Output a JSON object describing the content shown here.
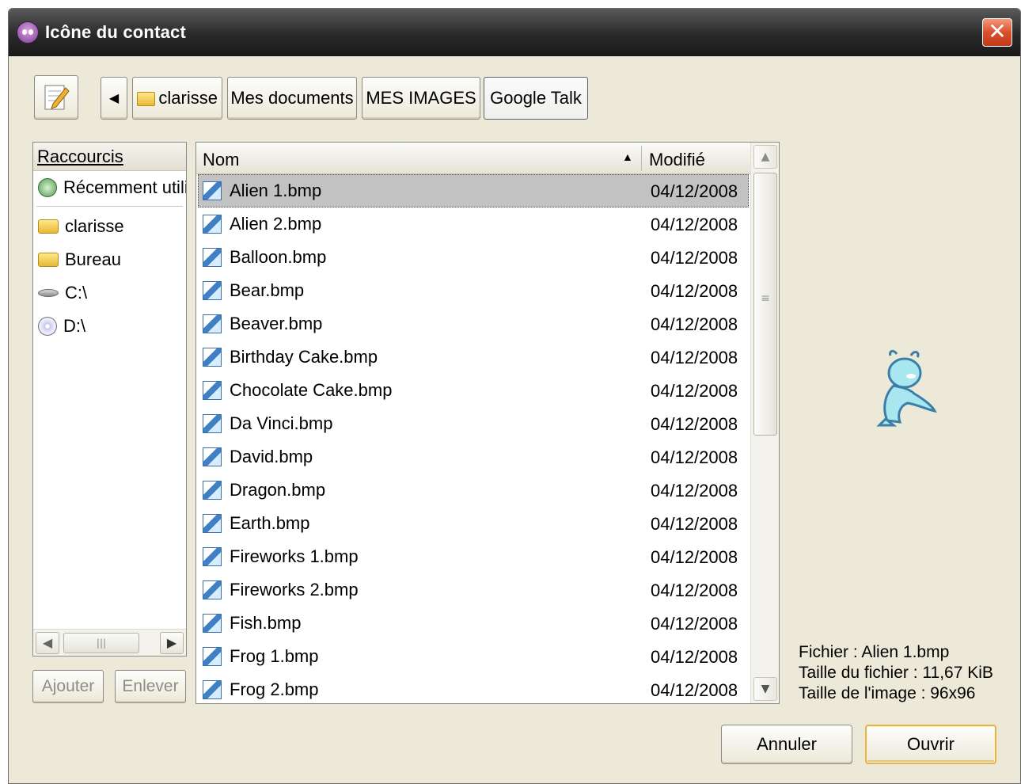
{
  "window": {
    "title": "Icône du contact",
    "close_glyph": "✕"
  },
  "toolbar": {
    "edit_icon": "pencil-notepad-icon",
    "back_glyph": "◀",
    "breadcrumbs": [
      "clarisse",
      "Mes documents",
      "MES IMAGES",
      "Google Talk"
    ],
    "active_crumb": "Google Talk"
  },
  "shortcuts": {
    "header": "Raccourcis",
    "items": [
      {
        "label": "Récemment utilisé",
        "icon": "recent-icon"
      },
      {
        "label": "clarisse",
        "icon": "folder-icon"
      },
      {
        "label": "Bureau",
        "icon": "folder-icon"
      },
      {
        "label": "C:\\",
        "icon": "hard-drive-icon"
      },
      {
        "label": "D:\\",
        "icon": "cd-drive-icon"
      }
    ],
    "add_label": "Ajouter",
    "remove_label": "Enlever"
  },
  "file_list": {
    "columns": {
      "name": "Nom",
      "modified": "Modifié"
    },
    "sort_indicator": "▲",
    "selected_index": 0,
    "files": [
      {
        "name": "Alien 1.bmp",
        "date": "04/12/2008"
      },
      {
        "name": "Alien 2.bmp",
        "date": "04/12/2008"
      },
      {
        "name": "Balloon.bmp",
        "date": "04/12/2008"
      },
      {
        "name": "Bear.bmp",
        "date": "04/12/2008"
      },
      {
        "name": "Beaver.bmp",
        "date": "04/12/2008"
      },
      {
        "name": "Birthday Cake.bmp",
        "date": "04/12/2008"
      },
      {
        "name": "Chocolate Cake.bmp",
        "date": "04/12/2008"
      },
      {
        "name": "Da Vinci.bmp",
        "date": "04/12/2008"
      },
      {
        "name": "David.bmp",
        "date": "04/12/2008"
      },
      {
        "name": "Dragon.bmp",
        "date": "04/12/2008"
      },
      {
        "name": "Earth.bmp",
        "date": "04/12/2008"
      },
      {
        "name": "Fireworks 1.bmp",
        "date": "04/12/2008"
      },
      {
        "name": "Fireworks 2.bmp",
        "date": "04/12/2008"
      },
      {
        "name": "Fish.bmp",
        "date": "04/12/2008"
      },
      {
        "name": "Frog 1.bmp",
        "date": "04/12/2008"
      },
      {
        "name": "Frog 2.bmp",
        "date": "04/12/2008"
      }
    ]
  },
  "preview": {
    "icon": "alien-preview-icon",
    "file_line": "Fichier : Alien 1.bmp",
    "size_line": "Taille du fichier : 11,67 KiB",
    "dims_line": "Taille de l'image : 96x96"
  },
  "actions": {
    "cancel_label": "Annuler",
    "open_label": "Ouvrir"
  },
  "colors": {
    "dialog_bg": "#ece9d8",
    "titlebar": "#2a2a2a",
    "selection": "#c2c2c2",
    "close_button": "#d8502c",
    "default_button_border": "#e5b54a"
  }
}
